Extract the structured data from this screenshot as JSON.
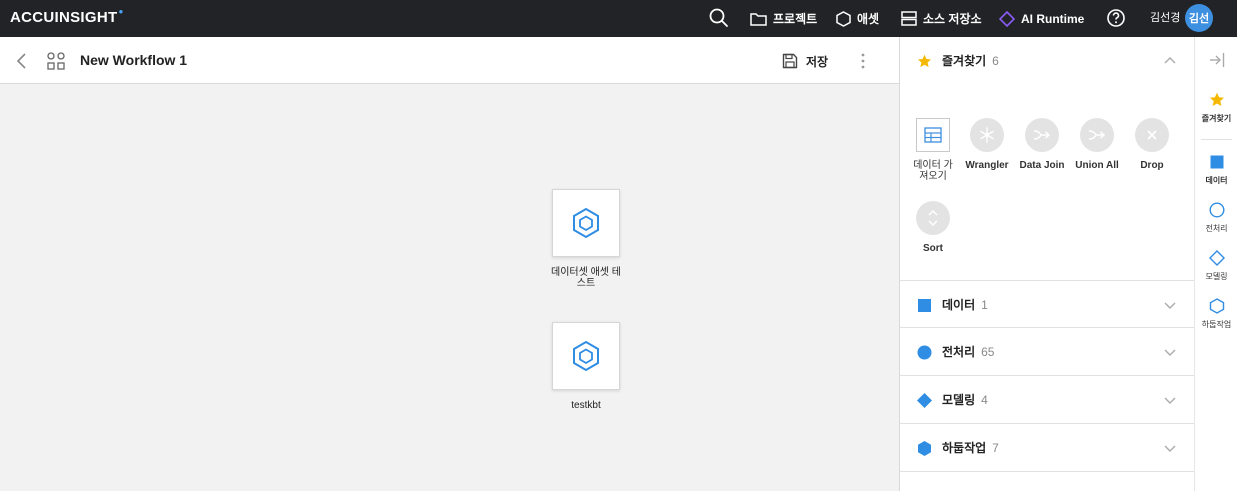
{
  "app": {
    "logo": "ACCUINSIGHT",
    "nav": {
      "project": "프로젝트",
      "asset": "애셋",
      "source_repo": "소스 저장소",
      "ai_runtime": "AI Runtime"
    },
    "user_name": "김선경",
    "avatar_text": "김선"
  },
  "workflow": {
    "title": "New Workflow 1",
    "save_label": "저장"
  },
  "canvas": {
    "nodes": [
      {
        "label": "데이터셋 애셋 테스트"
      },
      {
        "label": "testkbt"
      }
    ]
  },
  "panel": {
    "favorites": {
      "title": "즐겨찾기",
      "count": "6",
      "tools": [
        {
          "label": "데이터 가져오기",
          "icon": "table-icon"
        },
        {
          "label": "Wrangler",
          "icon": "snowflake-icon"
        },
        {
          "label": "Data Join",
          "icon": "merge-icon"
        },
        {
          "label": "Union All",
          "icon": "merge-icon"
        },
        {
          "label": "Drop",
          "icon": "close-icon"
        },
        {
          "label": "Sort",
          "icon": "sort-icon"
        }
      ]
    },
    "sections": [
      {
        "title": "데이터",
        "count": "1",
        "icon": "square-icon"
      },
      {
        "title": "전처리",
        "count": "65",
        "icon": "circle-icon"
      },
      {
        "title": "모델링",
        "count": "4",
        "icon": "diamond-icon"
      },
      {
        "title": "하둡작업",
        "count": "7",
        "icon": "hexagon-icon"
      }
    ]
  },
  "rail": {
    "items": [
      {
        "label": "즐겨찾기",
        "icon": "star-icon"
      },
      {
        "label": "데이터",
        "icon": "square-icon"
      },
      {
        "label": "전처리",
        "icon": "circle-icon"
      },
      {
        "label": "모델링",
        "icon": "diamond-icon"
      },
      {
        "label": "하둡작업",
        "icon": "hexagon-icon"
      }
    ]
  },
  "colors": {
    "topbar": "#222326",
    "accent": "#3d8fe0",
    "star": "#f5b800",
    "ai_runtime": "#8b5cf6"
  }
}
